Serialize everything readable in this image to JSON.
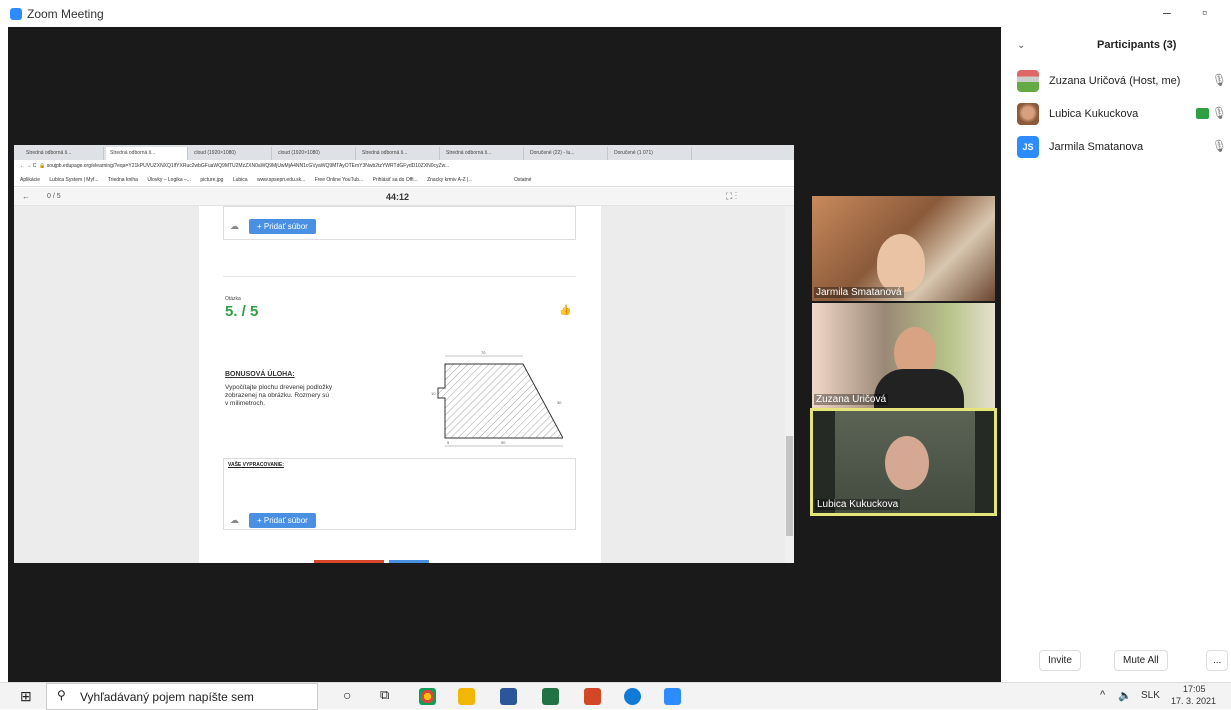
{
  "app": {
    "title": "Zoom Meeting",
    "minimize": "–",
    "restore": "▫"
  },
  "browser": {
    "tabs": [
      "Stredná odborná š...",
      "Stredná odborná š...",
      "cloud (1920×1080)",
      "cloud (1920×1080)",
      "Stredná odborná š...",
      "Stredná odborná š...",
      "Doručené (22) - lu...",
      "Doručené (1 071)"
    ],
    "address": "soujpb.edupage.org/elearning/?eqa=Y21kPUVUZXNXQ1lfYXRuc2wbGFuaWQ9MTU2MzZXN0aWQ9MjUwMjA4NN1cGVyaWQ9MTAyOTEmY3Nwb2tzYWRTdGFydD10ZXN0cyZw...",
    "bookmarks": [
      "Aplikácie",
      "Lubica System | Myf...",
      "Triedna kniha",
      "Úlovky – Logika –...",
      "picture.jpg",
      "Lubica",
      "www.spsepn.edu.sk...",
      "Free Online YouTub...",
      "Prihlásiť sa do Offi...",
      "Znacky krmiv A-Z |...",
      "Ostatné"
    ]
  },
  "quiz": {
    "progress": "0 / 5",
    "timer": "44:12",
    "add_file": "+ Pridať súbor",
    "question_label": "Otázka",
    "score": "5. / 5",
    "bonus_title": "BONUSOVÁ ÚLOHA:",
    "bonus_text_1": "Vypočítajte plochu drevenej podložky",
    "bonus_text_2": "zobrazenej na obrázku. Rozmery sú",
    "bonus_text_3": "v milimetroch.",
    "answer_label": "VAŠE VYPRACOVANIE:",
    "dim_top": "70",
    "dim_right": "30",
    "dim_bottom": "90",
    "dim_left": "5",
    "dim_notch": "10"
  },
  "videos": [
    {
      "name": "Jarmila Smatanová"
    },
    {
      "name": "Zuzana Uričová"
    },
    {
      "name": "Lubica Kukuckova"
    }
  ],
  "participants": {
    "header": "Participants (3)",
    "list": [
      {
        "name": "Zuzana Uričová (Host, me)"
      },
      {
        "name": "Lubica Kukuckova"
      },
      {
        "name": "Jarmila Smatanova",
        "initials": "JS"
      }
    ],
    "invite": "Invite",
    "mute_all": "Mute All",
    "more": "..."
  },
  "taskbar": {
    "search_placeholder": "Vyhľadávaný pojem napíšte sem",
    "lang": "SLK",
    "time": "17:05",
    "date": "17. 3. 2021"
  },
  "colors": {
    "zoom_blue": "#2d8cff",
    "accent_green": "#2ea043",
    "file_btn": "#4a90e2",
    "active_speaker": "#e5e57a"
  }
}
